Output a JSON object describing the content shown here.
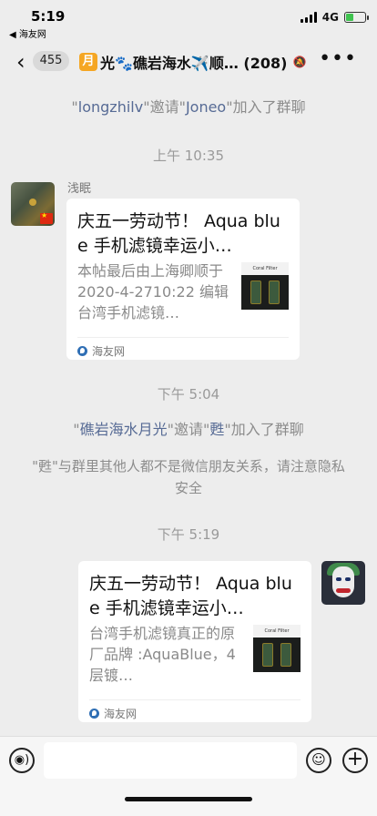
{
  "status_bar": {
    "time": "5:19",
    "back_app": "◀ 海友网",
    "network": "4G"
  },
  "nav": {
    "back_symbol": "‹",
    "unread_count": "455",
    "title_tag": "月",
    "title": "光🐾礁岩海水✈️顺… (208)",
    "mute_symbol": "🔕",
    "more_symbol": "•••"
  },
  "messages": {
    "join1": {
      "inviter": "longzhilv",
      "action": "邀请",
      "invitee": "Joneo",
      "suffix": "加入了群聊"
    },
    "time1": "上午 10:35",
    "msg1": {
      "sender": "浅眠",
      "title": "庆五一劳动节！ Aqua blue 手机滤镜幸运小…",
      "description": "本帖最后由上海卿顺于 2020-4-2710:22 编辑台湾手机滤镜…",
      "thumb_label": "Coral Filter",
      "source": "海友网"
    },
    "time2": "下午 5:04",
    "join2": {
      "inviter": "礁岩海水月光",
      "action": "邀请",
      "invitee": "甦",
      "suffix": "加入了群聊"
    },
    "privacy_notice": "\"甦\"与群里其他人都不是微信朋友关系，请注意隐私安全",
    "time3": "下午 5:19",
    "msg2": {
      "title": "庆五一劳动节！ Aqua blue 手机滤镜幸运小…",
      "description": "台湾手机滤镜真正的原厂品牌 :AquaBlue，4层镀…",
      "thumb_label": "Coral Filter",
      "source": "海友网"
    }
  },
  "input_bar": {
    "voice_symbol": "◉)",
    "emoji_symbol": "☺",
    "plus_symbol": "+",
    "text_value": ""
  }
}
